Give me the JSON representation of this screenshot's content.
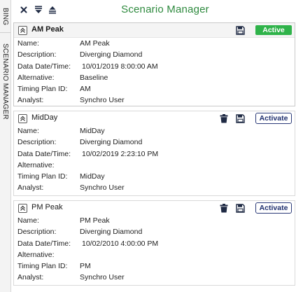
{
  "side_tabs": {
    "bing": "BING",
    "scenario_manager": "SCENARIO MANAGER"
  },
  "header": {
    "title": "Scenario Manager"
  },
  "field_labels": {
    "name": "Name:",
    "description": "Description:",
    "data_date_time": "Data Date/Time:",
    "alternative": "Alternative:",
    "timing_plan_id": "Timing Plan ID:",
    "analyst": "Analyst:"
  },
  "scenarios": [
    {
      "title": "AM Peak",
      "status_label": "Active",
      "name": "AM Peak",
      "description": "Diverging Diamond",
      "data_date_time": "10/01/2019 8:00:00 AM",
      "alternative": "Baseline",
      "timing_plan_id": "AM",
      "analyst": "Synchro User"
    },
    {
      "title": "MidDay",
      "status_label": "Activate",
      "name": "MidDay",
      "description": "Diverging Diamond",
      "data_date_time": "10/02/2019 2:23:10 PM",
      "alternative": "",
      "timing_plan_id": "MidDay",
      "analyst": "Synchro User"
    },
    {
      "title": "PM Peak",
      "status_label": "Activate",
      "name": "PM Peak",
      "description": "Diverging Diamond",
      "data_date_time": "10/02/2010 4:00:00 PM",
      "alternative": "",
      "timing_plan_id": "PM",
      "analyst": "Synchro User"
    }
  ],
  "colors": {
    "title": "#2e8a3e",
    "active_badge": "#2fb34a",
    "activate_border": "#2a3a78",
    "icon": "#1f2a44"
  },
  "icons": {
    "close": "close-icon",
    "collapse_all": "collapse-all-icon",
    "expand_all": "expand-all-icon",
    "panel_collapse": "chevron-up-icon",
    "delete": "trash-icon",
    "save": "save-icon"
  }
}
